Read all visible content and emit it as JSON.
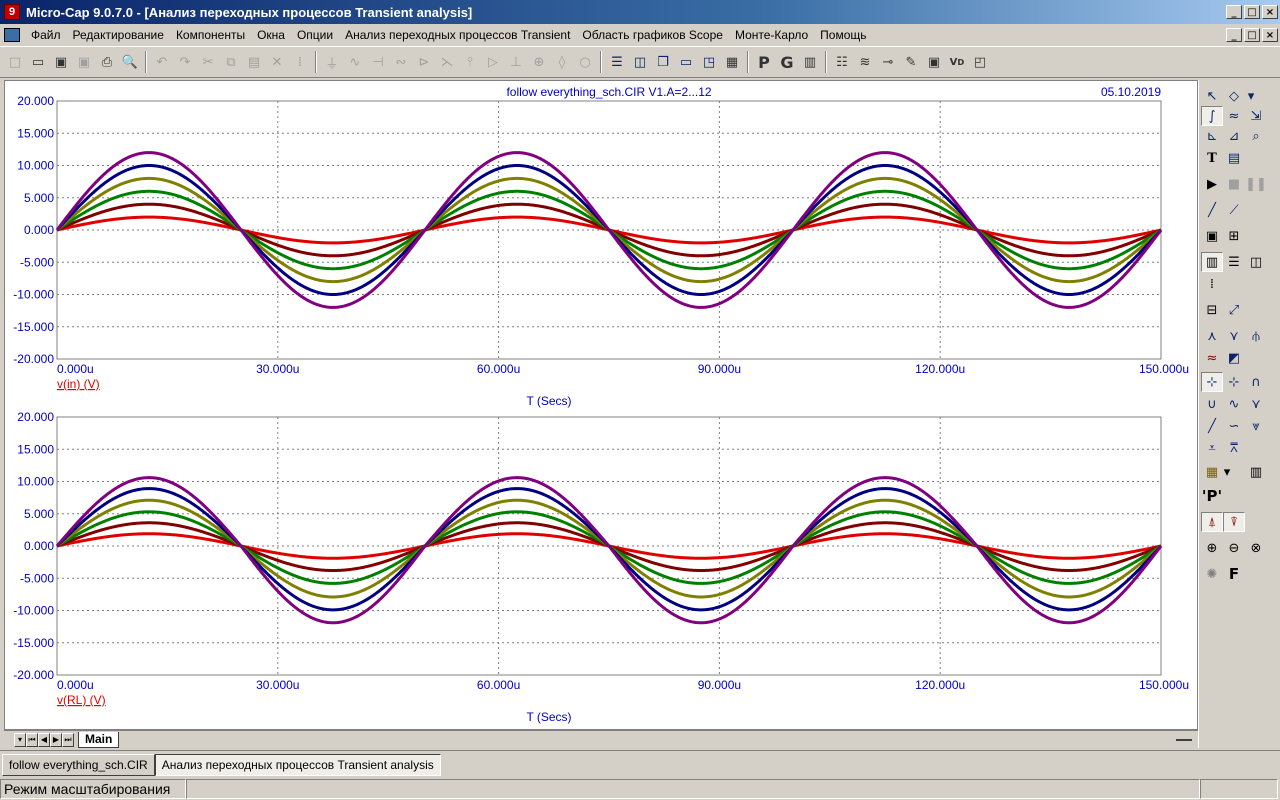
{
  "window": {
    "title": "Micro-Cap 9.0.7.0 - [Анализ переходных процессов Transient analysis]",
    "controls": [
      "_",
      "□",
      "×"
    ]
  },
  "menu": {
    "items": [
      "Файл",
      "Редактирование",
      "Компоненты",
      "Окна",
      "Опции",
      "Анализ переходных процессов Transient",
      "Область графиков Scope",
      "Монте-Карло",
      "Помощь"
    ]
  },
  "plot": {
    "header_title": "follow everything_sch.CIR V1.A=2...12",
    "date": "05.10.2019",
    "x_label": "T (Secs)",
    "x_ticks": [
      "0.000u",
      "30.000u",
      "60.000u",
      "90.000u",
      "120.000u",
      "150.000u"
    ],
    "y_ticks": [
      "20.000",
      "15.000",
      "10.000",
      "5.000",
      "0.000",
      "-5.000",
      "-10.000",
      "-15.000",
      "-20.000"
    ],
    "top_trace_label": "v(in) (V)",
    "bottom_trace_label": "v(RL) (V)"
  },
  "chart_data": [
    {
      "type": "line",
      "title": "follow everything_sch.CIR V1.A=2...12",
      "xlabel": "T (Secs)",
      "ylabel": "v(in) (V)",
      "xlim": [
        0,
        0.00015
      ],
      "ylim": [
        -20,
        20
      ],
      "grid": true,
      "frequency_hz": 20000,
      "series": [
        {
          "amplitude": 2,
          "color": "#e00000"
        },
        {
          "amplitude": 4,
          "color": "#800000"
        },
        {
          "amplitude": 6,
          "color": "#008000"
        },
        {
          "amplitude": 8,
          "color": "#808000"
        },
        {
          "amplitude": 10,
          "color": "#000080"
        },
        {
          "amplitude": 12,
          "color": "#800080"
        }
      ]
    },
    {
      "type": "line",
      "title": "",
      "xlabel": "T (Secs)",
      "ylabel": "v(RL) (V)",
      "xlim": [
        0,
        0.00015
      ],
      "ylim": [
        -20,
        20
      ],
      "grid": true,
      "frequency_hz": 20000,
      "series": [
        {
          "pos_peak": 1.9,
          "neg_peak": 1.9,
          "color": "#e00000"
        },
        {
          "pos_peak": 3.6,
          "neg_peak": 3.8,
          "color": "#800000"
        },
        {
          "pos_peak": 5.3,
          "neg_peak": 5.8,
          "color": "#008000"
        },
        {
          "pos_peak": 7.1,
          "neg_peak": 7.9,
          "color": "#808000"
        },
        {
          "pos_peak": 8.9,
          "neg_peak": 9.9,
          "color": "#000080"
        },
        {
          "pos_peak": 10.6,
          "neg_peak": 11.9,
          "color": "#800080"
        }
      ]
    }
  ],
  "sheet_tabs": {
    "active": "Main"
  },
  "doc_tabs": [
    "follow everything_sch.CIR",
    "Анализ переходных процессов Transient analysis"
  ],
  "status": {
    "mode": "Режим масштабирования"
  }
}
